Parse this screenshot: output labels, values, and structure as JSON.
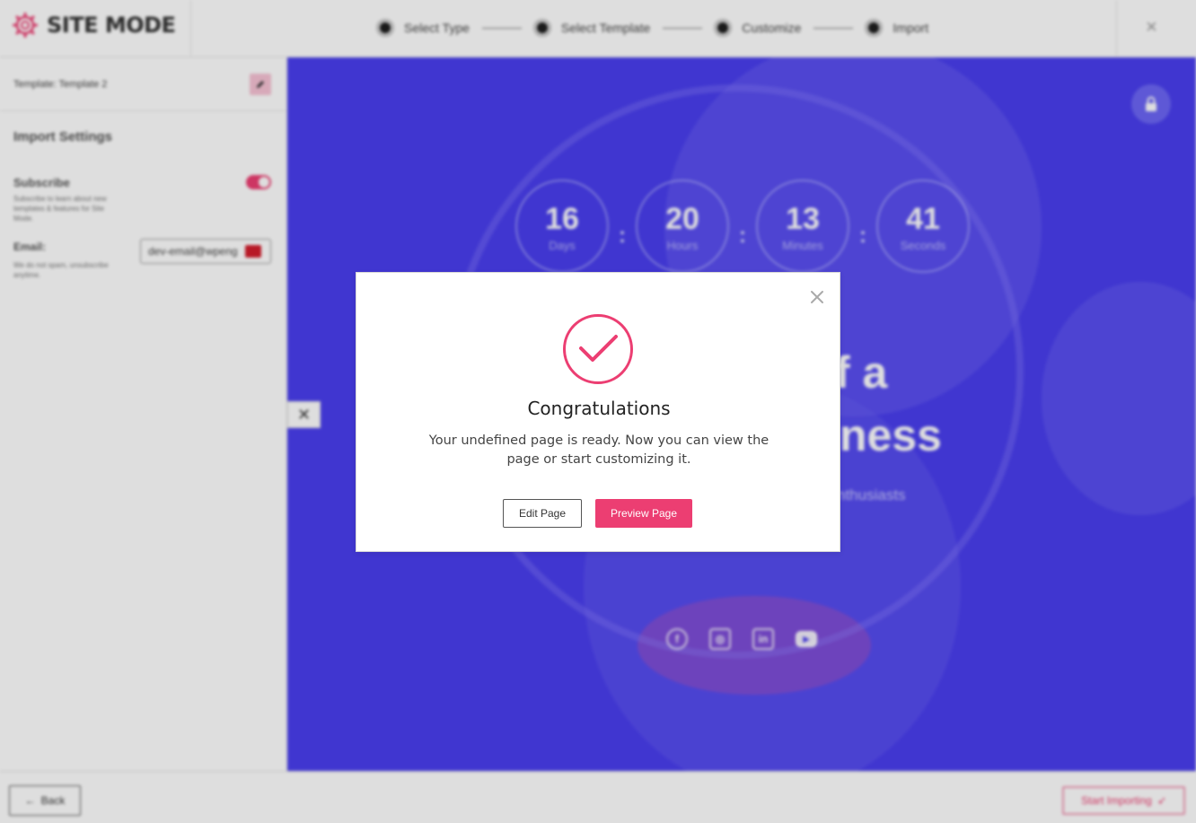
{
  "app": {
    "brand": "SITE MODE",
    "steps": [
      {
        "label": "Select Type"
      },
      {
        "label": "Select Template"
      },
      {
        "label": "Customize"
      },
      {
        "label": "Import"
      }
    ],
    "close_symbol": "×"
  },
  "sidebar": {
    "template_label": "Template: Template 2",
    "import_settings_heading": "Import Settings",
    "subscribe_title": "Subscribe",
    "subscribe_desc": "Subscribe to learn about new templates & features for Site Mode.",
    "subscribe_on": true,
    "email_label": "Email:",
    "email_desc": "We do not spam, unsubscribe anytime.",
    "email_value": "dev-email@wpeng"
  },
  "preview": {
    "countdown": [
      {
        "value": "16",
        "unit": "Days"
      },
      {
        "value": "20",
        "unit": "Hours"
      },
      {
        "value": "13",
        "unit": "Minutes"
      },
      {
        "value": "41",
        "unit": "Seconds"
      }
    ],
    "separator": ":",
    "hero_line1": "f a",
    "hero_line2": "ness",
    "hero_line3": "nthusiasts",
    "social_icons": [
      "facebook-icon",
      "instagram-icon",
      "linkedin-icon",
      "youtube-icon"
    ]
  },
  "bottom": {
    "back_label": "Back",
    "start_label": "Start Importing"
  },
  "modal": {
    "title": "Congratulations",
    "message": "Your undefined page is ready. Now you can view the page or start customizing it.",
    "edit_label": "Edit Page",
    "preview_label": "Preview Page"
  },
  "colors": {
    "accent": "#ec3e72",
    "preview_bg": "#4a3fef"
  }
}
